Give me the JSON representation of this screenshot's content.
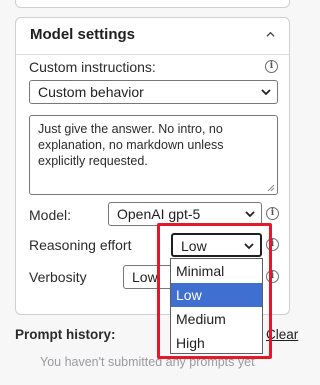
{
  "model_settings": {
    "title": "Model settings",
    "custom_instructions": {
      "label": "Custom instructions:",
      "selected": "Custom behavior",
      "text": "Just give the answer. No intro, no explanation, no markdown unless explicitly requested."
    },
    "model": {
      "label": "Model:",
      "selected": "OpenAI gpt-5"
    },
    "reasoning_effort": {
      "label": "Reasoning effort",
      "selected": "Low",
      "options": [
        "Minimal",
        "Low",
        "Medium",
        "High"
      ],
      "highlighted_option": "Low"
    },
    "verbosity": {
      "label": "Verbosity",
      "selected": "Low"
    }
  },
  "prompt_history": {
    "title": "Prompt history:",
    "clear_label": "Clear",
    "empty_text": "You haven't submitted any prompts yet"
  },
  "colors": {
    "highlight_box": "#e5182a",
    "selected_option": "#3f6fd1",
    "panel_border": "#cfcfd4"
  },
  "icons": [
    "chevron-up-icon",
    "info-icon",
    "chevron-down-icon",
    "resize-grip-icon"
  ]
}
